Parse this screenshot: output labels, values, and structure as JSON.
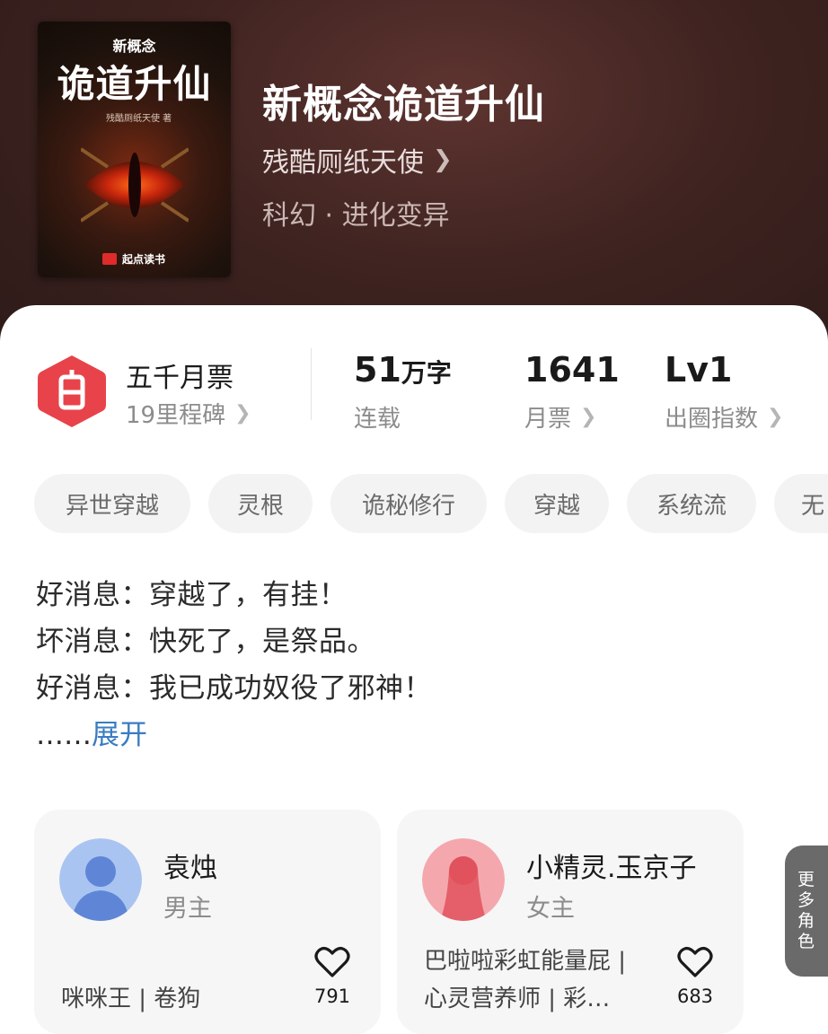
{
  "book": {
    "cover": {
      "series": "新概念",
      "title": "诡道升仙",
      "author": "残酷厕纸天使 著",
      "publisher": "起点读书"
    },
    "title": "新概念诡道升仙",
    "author": "残酷厕纸天使",
    "genre": "科幻 · 进化变异"
  },
  "stats": {
    "milestone": {
      "title": "五千月票",
      "sub": "19里程碑"
    },
    "words": {
      "value": "51",
      "unit": "万字",
      "label": "连载"
    },
    "monthly_tickets": {
      "value": "1641",
      "label": "月票"
    },
    "influence": {
      "value": "Lv1",
      "label": "出圈指数"
    }
  },
  "tags": [
    "异世穿越",
    "灵根",
    "诡秘修行",
    "穿越",
    "系统流",
    "无"
  ],
  "description": {
    "lines": [
      "好消息：穿越了，有挂！",
      "坏消息：快死了，是祭品。",
      "好消息：我已成功奴役了邪神！"
    ],
    "ellipsis": "……",
    "expand_label": "展开"
  },
  "characters": [
    {
      "name": "袁烛",
      "role": "男主",
      "desc_lines": [
        "咪咪王 | 卷狗"
      ],
      "likes": "791"
    },
    {
      "name": "小精灵.玉京子",
      "role": "女主",
      "desc_lines": [
        "巴啦啦彩虹能量屁 |",
        "心灵营养师 | 彩…"
      ],
      "likes": "683"
    }
  ],
  "more_roles_label": "更多角色",
  "colors": {
    "header_bg": "#3e2320",
    "accent_red": "#e8434a",
    "link_blue": "#3a7cc1"
  },
  "icons": {
    "chevron": "chevron-right-icon",
    "badge": "milestone-badge-icon",
    "heart": "heart-outline-icon"
  }
}
